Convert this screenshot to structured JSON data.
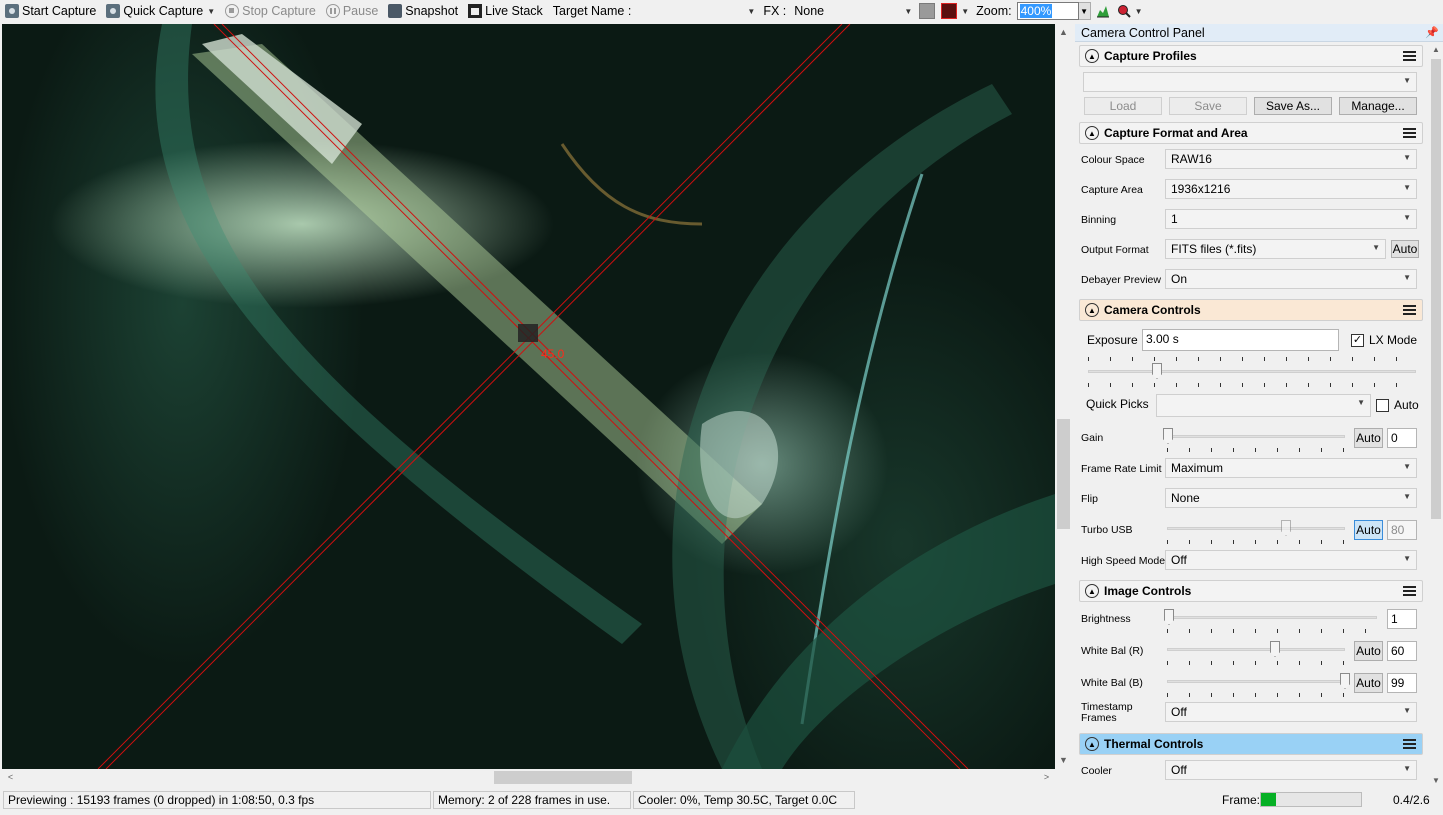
{
  "toolbar": {
    "start_capture": "Start Capture",
    "quick_capture": "Quick Capture",
    "stop_capture": "Stop Capture",
    "pause": "Pause",
    "snapshot": "Snapshot",
    "live_stack": "Live Stack",
    "target_name_label": "Target Name :",
    "target_name_value": "",
    "fx_label": "FX :",
    "fx_value": "None",
    "zoom_label": "Zoom:",
    "zoom_value": "400%"
  },
  "preview": {
    "angle_label": "45.0",
    "reticle_color": "#ff2a1a"
  },
  "panel": {
    "title": "Camera Control Panel",
    "capture_profiles": {
      "title": "Capture Profiles",
      "profile_value": "",
      "load": "Load",
      "save": "Save",
      "save_as": "Save As...",
      "manage": "Manage..."
    },
    "capture_format": {
      "title": "Capture Format and Area",
      "colour_space_label": "Colour Space",
      "colour_space": "RAW16",
      "capture_area_label": "Capture Area",
      "capture_area": "1936x1216",
      "binning_label": "Binning",
      "binning": "1",
      "output_format_label": "Output Format",
      "output_format": "FITS files (*.fits)",
      "output_auto": "Auto",
      "debayer_label": "Debayer Preview",
      "debayer": "On"
    },
    "camera_controls": {
      "title": "Camera Controls",
      "exposure_label": "Exposure",
      "exposure_value": "3.00 s",
      "lx_mode_label": "LX Mode",
      "lx_mode_checked": true,
      "quick_picks_label": "Quick Picks",
      "quick_picks_value": "",
      "quick_picks_auto": "Auto",
      "gain_label": "Gain",
      "gain_auto": "Auto",
      "gain_value": "0",
      "frame_rate_label": "Frame Rate Limit",
      "frame_rate": "Maximum",
      "flip_label": "Flip",
      "flip": "None",
      "turbo_label": "Turbo USB",
      "turbo_auto": "Auto",
      "turbo_value": "80",
      "high_speed_label": "High Speed Mode",
      "high_speed": "Off"
    },
    "image_controls": {
      "title": "Image Controls",
      "brightness_label": "Brightness",
      "brightness_value": "1",
      "wb_r_label": "White Bal (R)",
      "wb_r_auto": "Auto",
      "wb_r_value": "60",
      "wb_b_label": "White Bal (B)",
      "wb_b_auto": "Auto",
      "wb_b_value": "99",
      "timestamp_label_1": "Timestamp",
      "timestamp_label_2": "Frames",
      "timestamp": "Off"
    },
    "thermal_controls": {
      "title": "Thermal Controls",
      "cooler_label": "Cooler",
      "cooler": "Off"
    }
  },
  "status": {
    "previewing": "Previewing : 15193 frames (0 dropped) in 1:08:50, 0.3 fps",
    "memory": "Memory: 2 of 228 frames in use.",
    "cooler": "Cooler: 0%, Temp 30.5C, Target 0.0C",
    "frame_label": "Frame:",
    "frame_ratio": "0.4/2.6",
    "frame_progress": 0.15
  },
  "colors": {
    "accent_blue": "#99d1f5",
    "camera_header": "#fae8d5",
    "progress_green": "#06b025"
  }
}
